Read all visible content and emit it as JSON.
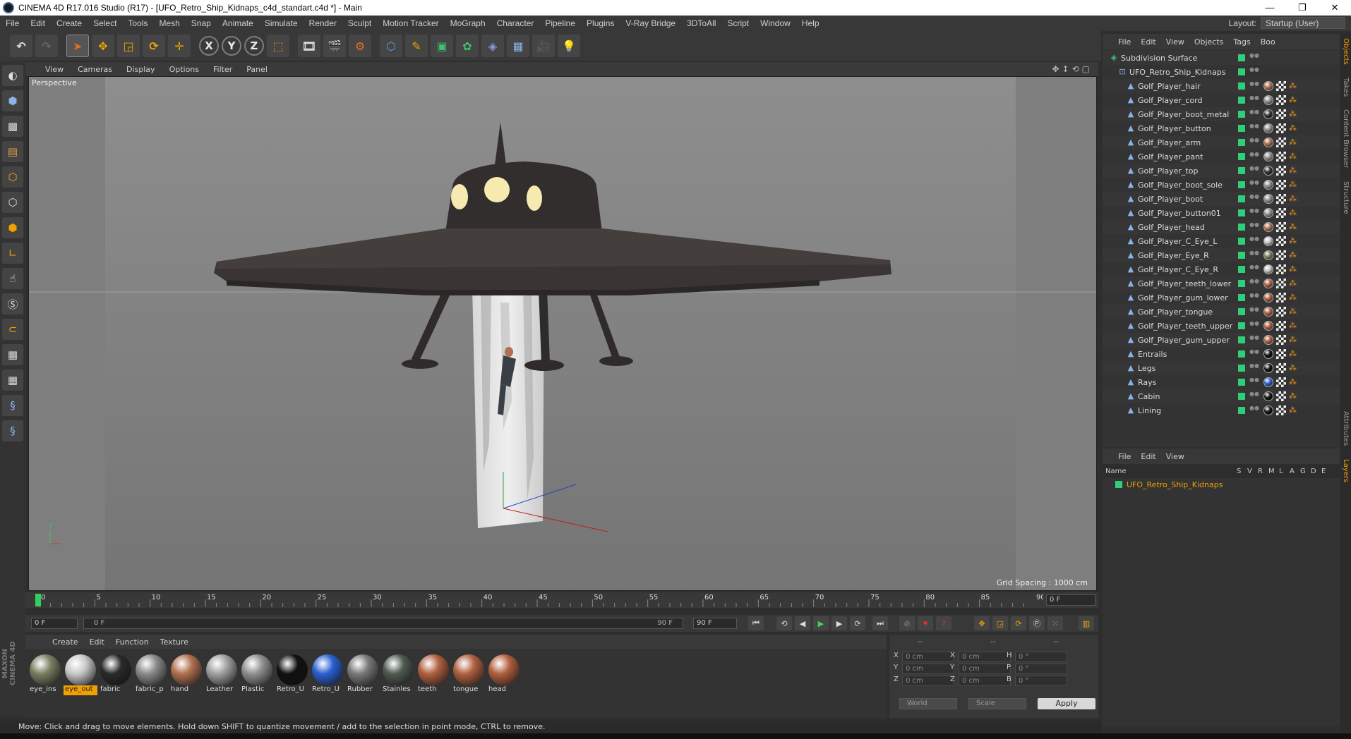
{
  "window": {
    "title": "CINEMA 4D R17.016 Studio (R17) - [UFO_Retro_Ship_Kidnaps_c4d_standart.c4d *] - Main",
    "controls": [
      "—",
      "❐",
      "✕"
    ]
  },
  "menubar": {
    "items": [
      "File",
      "Edit",
      "Create",
      "Select",
      "Tools",
      "Mesh",
      "Snap",
      "Animate",
      "Simulate",
      "Render",
      "Sculpt",
      "Motion Tracker",
      "MoGraph",
      "Character",
      "Pipeline",
      "Plugins",
      "V-Ray Bridge",
      "3DToAll",
      "Script",
      "Window",
      "Help"
    ],
    "layout_label": "Layout:",
    "layout_value": "Startup (User)"
  },
  "toolbar": {
    "axis_x": "X",
    "axis_y": "Y",
    "axis_z": "Z"
  },
  "viewport": {
    "menu": [
      "View",
      "Cameras",
      "Display",
      "Options",
      "Filter",
      "Panel"
    ],
    "label": "Perspective",
    "grid_spacing": "Grid Spacing : 1000 cm",
    "nav_icons": "✥↕⟲▢"
  },
  "timeline": {
    "ticks": [
      "0",
      "5",
      "10",
      "15",
      "20",
      "25",
      "30",
      "35",
      "40",
      "45",
      "50",
      "55",
      "60",
      "65",
      "70",
      "75",
      "80",
      "85",
      "90"
    ],
    "frame_field": "0 F"
  },
  "transport": {
    "start": "0 F",
    "range_start": "0 F",
    "range_end": "90 F",
    "end": "90 F"
  },
  "materials": {
    "menu": [
      "Create",
      "Edit",
      "Function",
      "Texture"
    ],
    "items": [
      {
        "name": "eye_ins",
        "color": "#7a8060"
      },
      {
        "name": "eye_out",
        "color": "#c8c8c8",
        "active": true
      },
      {
        "name": "fabric",
        "color": "#2a2a2a"
      },
      {
        "name": "fabric_p",
        "color": "#8a8a8a"
      },
      {
        "name": "hand",
        "color": "#b07050"
      },
      {
        "name": "Leather",
        "color": "#a0a0a0"
      },
      {
        "name": "Plastic",
        "color": "#909090"
      },
      {
        "name": "Retro_U",
        "color": "#101010"
      },
      {
        "name": "Retro_U",
        "color": "#2a60d0"
      },
      {
        "name": "Rubber",
        "color": "#7a7a7a"
      },
      {
        "name": "Stainles",
        "color": "#505a50"
      },
      {
        "name": "teeth",
        "color": "#b06040"
      },
      {
        "name": "tongue",
        "color": "#b06040"
      },
      {
        "name": "head",
        "color": "#b06040"
      }
    ]
  },
  "coords": {
    "head": [
      "--",
      "--",
      "--"
    ],
    "rows": [
      {
        "l1": "X",
        "v1": "0 cm",
        "l2": "X",
        "v2": "0 cm",
        "l3": "H",
        "v3": "0 °"
      },
      {
        "l1": "Y",
        "v1": "0 cm",
        "l2": "Y",
        "v2": "0 cm",
        "l3": "P",
        "v3": "0 °"
      },
      {
        "l1": "Z",
        "v1": "0 cm",
        "l2": "Z",
        "v2": "0 cm",
        "l3": "B",
        "v3": "0 °"
      }
    ],
    "mode1": "World",
    "mode2": "Scale",
    "apply": "Apply"
  },
  "status": "Move: Click and drag to move elements. Hold down SHIFT to quantize movement / add to the selection in point mode, CTRL to remove.",
  "object_manager": {
    "menu": [
      "File",
      "Edit",
      "View",
      "Objects",
      "Tags",
      "Boo"
    ],
    "objects": [
      {
        "name": "Subdivision Surface",
        "indent": 0,
        "tag": ""
      },
      {
        "name": "UFO_Retro_Ship_Kidnaps",
        "indent": 1,
        "tag": ""
      },
      {
        "name": "Golf_Player_hair",
        "indent": 2,
        "tag": "#b07050"
      },
      {
        "name": "Golf_Player_cord",
        "indent": 2,
        "tag": "#909090"
      },
      {
        "name": "Golf_Player_boot_metal",
        "indent": 2,
        "tag": "#303030"
      },
      {
        "name": "Golf_Player_button",
        "indent": 2,
        "tag": "#909090"
      },
      {
        "name": "Golf_Player_arm",
        "indent": 2,
        "tag": "#b07050"
      },
      {
        "name": "Golf_Player_pant",
        "indent": 2,
        "tag": "#909090"
      },
      {
        "name": "Golf_Player_top",
        "indent": 2,
        "tag": "#303030"
      },
      {
        "name": "Golf_Player_boot_sole",
        "indent": 2,
        "tag": "#909090"
      },
      {
        "name": "Golf_Player_boot",
        "indent": 2,
        "tag": "#909090"
      },
      {
        "name": "Golf_Player_button01",
        "indent": 2,
        "tag": "#909090"
      },
      {
        "name": "Golf_Player_head",
        "indent": 2,
        "tag": "#b07050"
      },
      {
        "name": "Golf_Player_C_Eye_L",
        "indent": 2,
        "tag": "#c8c8c8"
      },
      {
        "name": "Golf_Player_Eye_R",
        "indent": 2,
        "tag": "#7a8060"
      },
      {
        "name": "Golf_Player_C_Eye_R",
        "indent": 2,
        "tag": "#c8c8c8"
      },
      {
        "name": "Golf_Player_teeth_lower",
        "indent": 2,
        "tag": "#b06040"
      },
      {
        "name": "Golf_Player_gum_lower",
        "indent": 2,
        "tag": "#b06040"
      },
      {
        "name": "Golf_Player_tongue",
        "indent": 2,
        "tag": "#b06040"
      },
      {
        "name": "Golf_Player_teeth_upper",
        "indent": 2,
        "tag": "#b06040"
      },
      {
        "name": "Golf_Player_gum_upper",
        "indent": 2,
        "tag": "#b06040"
      },
      {
        "name": "Entrails",
        "indent": 2,
        "tag": "#101010"
      },
      {
        "name": "Legs",
        "indent": 2,
        "tag": "#101010"
      },
      {
        "name": "Rays",
        "indent": 2,
        "tag": "#2a60d0"
      },
      {
        "name": "Cabin",
        "indent": 2,
        "tag": "#101010"
      },
      {
        "name": "Lining",
        "indent": 2,
        "tag": "#101010"
      }
    ]
  },
  "layer_manager": {
    "menu": [
      "File",
      "Edit",
      "View"
    ],
    "columns": [
      "Name",
      "S",
      "V",
      "R",
      "M",
      "L",
      "A",
      "G",
      "D",
      "E"
    ],
    "layers": [
      {
        "name": "UFO_Retro_Ship_Kidnaps"
      }
    ]
  },
  "side_tabs": [
    "Objects",
    "Takes",
    "Content Browser",
    "Structure",
    "Attributes",
    "Layers"
  ]
}
